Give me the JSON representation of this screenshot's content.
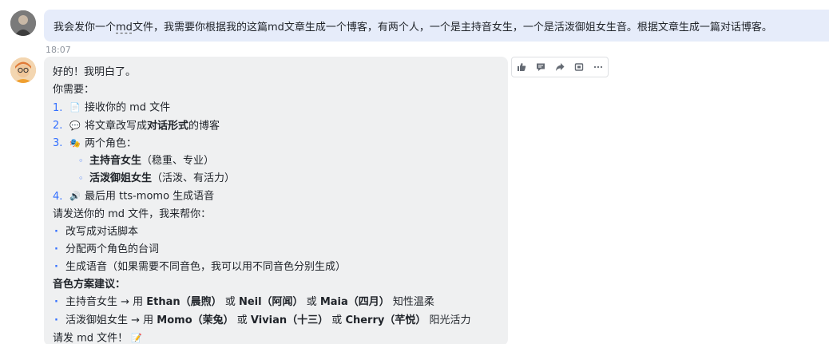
{
  "user_message": {
    "part1": "我会发你一个",
    "md": "md",
    "part2": "文件，我需要你根据我的这篇md文章生成一个博客，有两个人，一个是主持音女生，一个是活泼御姐女生音。根据文章生成一篇对话博客。"
  },
  "timestamp": "18:07",
  "reply": {
    "greeting": "好的！我明白了。",
    "need_label": "你需要：",
    "steps": [
      {
        "num": "1.",
        "icon": "📄",
        "pre": "接收你的 md 文件",
        "bold": "",
        "post": ""
      },
      {
        "num": "2.",
        "icon": "💬",
        "pre": "将文章改写成",
        "bold": "对话形式",
        "post": "的博客"
      },
      {
        "num": "3.",
        "icon": "🎭",
        "pre": "两个角色：",
        "bold": "",
        "post": ""
      },
      {
        "num": "4.",
        "icon": "🔊",
        "pre": "最后用 tts-momo 生成语音",
        "bold": "",
        "post": ""
      }
    ],
    "roles": [
      {
        "bold": "主持音女生",
        "post": "（稳重、专业）"
      },
      {
        "bold": "活泼御姐女生",
        "post": "（活泼、有活力）"
      }
    ],
    "send_prompt": "请发送你的 md 文件，我来帮你：",
    "help_items": [
      "改写成对话脚本",
      "分配两个角色的台词",
      "生成语音（如果需要不同音色，我可以用不同音色分别生成）"
    ],
    "voice_title": "音色方案建议：",
    "voice_host": {
      "pre": "主持音女生 → 用 ",
      "v1": "Ethan（晨煦）",
      "or1": " 或 ",
      "v2": "Neil（阿闻）",
      "or2": " 或 ",
      "v3": "Maia（四月）",
      "post": " 知性温柔"
    },
    "voice_lively": {
      "pre": "活泼御姐女生 → 用 ",
      "v1": "Momo（茉兔）",
      "or1": " 或 ",
      "v2": "Vivian（十三）",
      "or2": " 或 ",
      "v3": "Cherry（芊悦）",
      "post": " 阳光活力"
    },
    "closing": "请发 md 文件！",
    "closing_icon": "📝"
  },
  "actions": [
    "thumbs-up-icon",
    "comment-icon",
    "forward-icon",
    "pin-icon",
    "more-icon"
  ],
  "colors": {
    "accent": "#3370ff",
    "user_bubble": "#e6ecfa",
    "bot_bubble": "#eff0f1"
  }
}
